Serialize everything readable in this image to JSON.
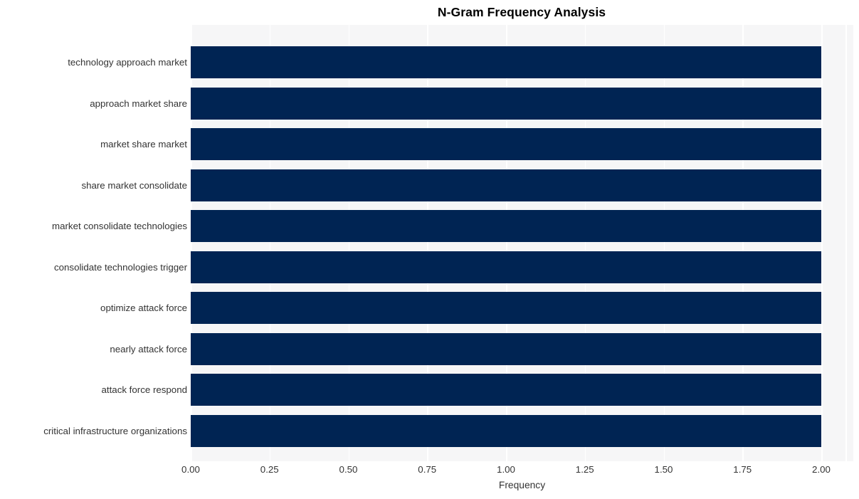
{
  "chart_data": {
    "type": "bar",
    "orientation": "horizontal",
    "title": "N-Gram Frequency Analysis",
    "xlabel": "Frequency",
    "ylabel": "",
    "categories": [
      "technology approach market",
      "approach market share",
      "market share market",
      "share market consolidate",
      "market consolidate technologies",
      "consolidate technologies trigger",
      "optimize attack force",
      "nearly attack force",
      "attack force respond",
      "critical infrastructure organizations"
    ],
    "values": [
      2,
      2,
      2,
      2,
      2,
      2,
      2,
      2,
      2,
      2
    ],
    "xlim": [
      0.0,
      2.0
    ],
    "xticks": [
      0.0,
      0.25,
      0.5,
      0.75,
      1.0,
      1.25,
      1.5,
      1.75,
      2.0
    ],
    "xtick_labels": [
      "0.00",
      "0.25",
      "0.50",
      "0.75",
      "1.00",
      "1.25",
      "1.50",
      "1.75",
      "2.00"
    ],
    "grid": true,
    "grid_axis": "x",
    "legend": false,
    "legend_position": "none",
    "bar_color": "#002453",
    "plot_background": "#f6f6f7",
    "gridline_color": "#ffffff",
    "tick_label_color": "#333333",
    "title_color": "#000000"
  }
}
